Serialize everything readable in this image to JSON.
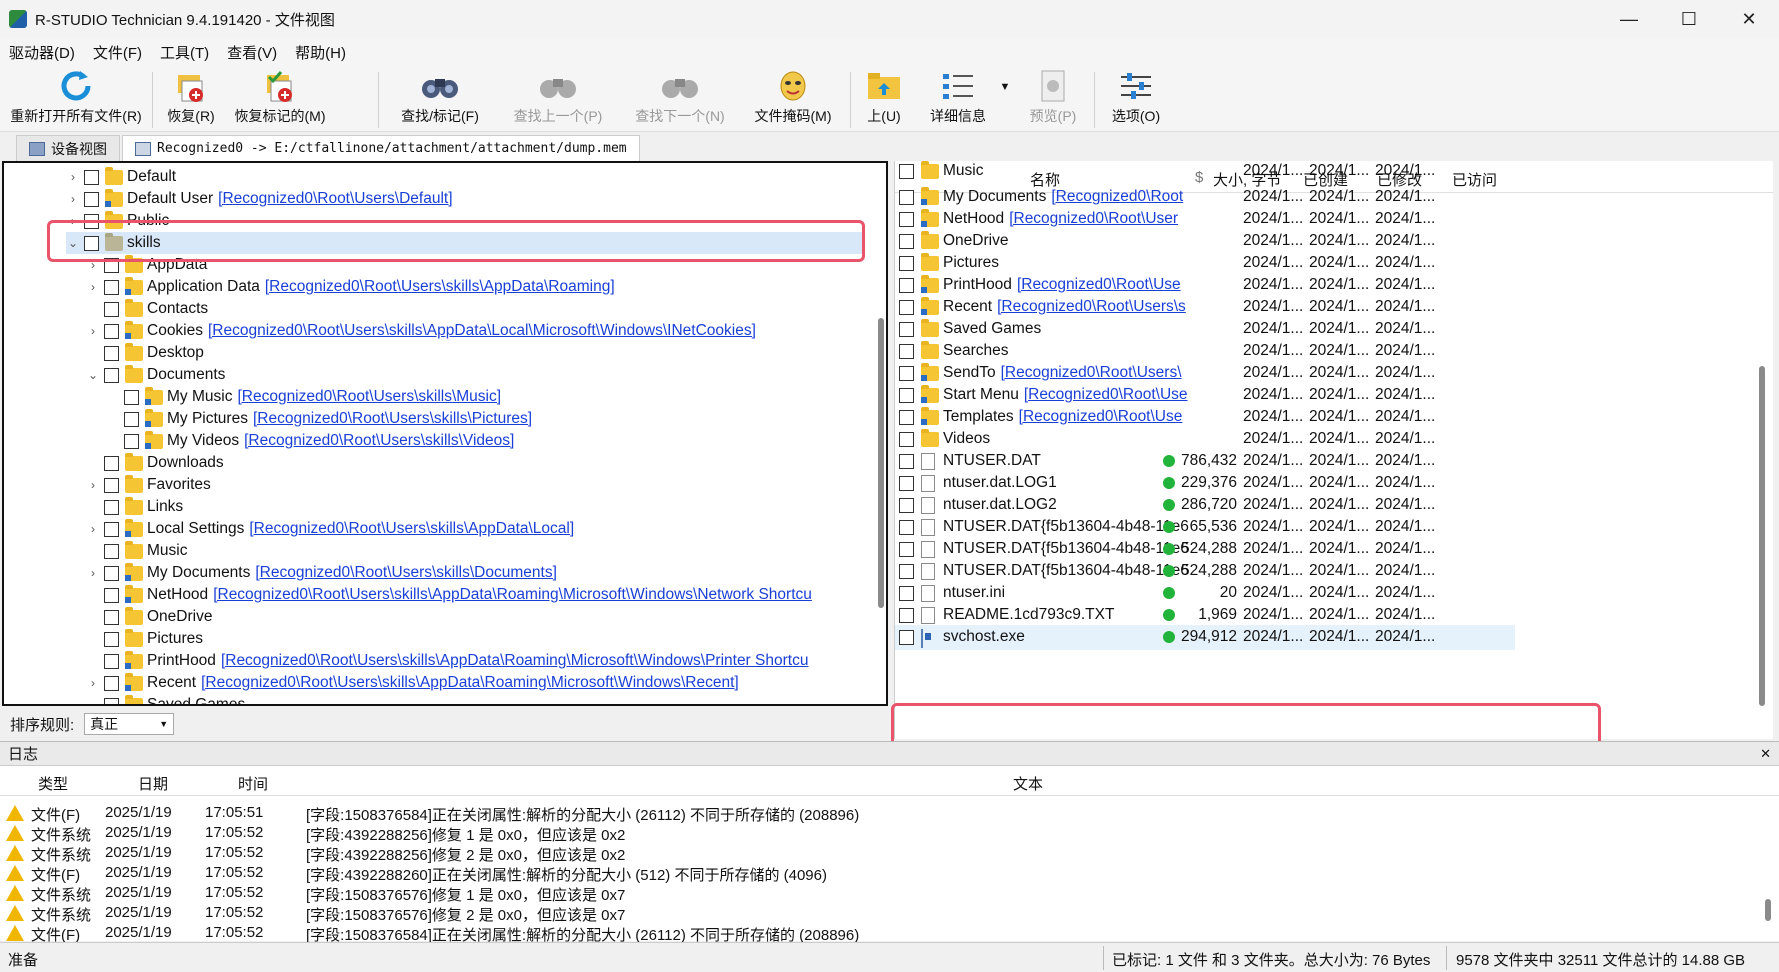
{
  "window": {
    "title": "R-STUDIO Technician 9.4.191420 - 文件视图"
  },
  "menu": [
    "驱动器(D)",
    "文件(F)",
    "工具(T)",
    "查看(V)",
    "帮助(H)"
  ],
  "toolbar": {
    "reopen": "重新打开所有文件(R)",
    "recover": "恢复(R)",
    "recover_marked": "恢复标记的(M)",
    "find_mark": "查找/标记(F)",
    "find_prev": "查找上一个(P)",
    "find_next": "查找下一个(N)",
    "file_mask": "文件掩码(M)",
    "up": "上(U)",
    "details": "详细信息",
    "preview": "预览(P)",
    "options": "选项(O)"
  },
  "tabs": {
    "device_view": "设备视图",
    "file_view": "Recognized0 -> E:/ctfallinone/attachment/attachment/dump.mem"
  },
  "tree": [
    {
      "name": "Default",
      "link": "",
      "level": 0,
      "expander": "›"
    },
    {
      "name": "Default User",
      "link": "[Recognized0\\Root\\Users\\Default]",
      "level": 0,
      "expander": "›"
    },
    {
      "name": "Public",
      "link": "",
      "level": 0,
      "expander": "›"
    },
    {
      "name": "skills",
      "link": "",
      "level": 0,
      "expander": "⌄"
    },
    {
      "name": "AppData",
      "link": "",
      "level": 1,
      "expander": "›"
    },
    {
      "name": "Application Data",
      "link": "[Recognized0\\Root\\Users\\skills\\AppData\\Roaming]",
      "level": 1,
      "expander": "›"
    },
    {
      "name": "Contacts",
      "link": "",
      "level": 1,
      "expander": ""
    },
    {
      "name": "Cookies",
      "link": "[Recognized0\\Root\\Users\\skills\\AppData\\Local\\Microsoft\\Windows\\INetCookies]",
      "level": 1,
      "expander": "›"
    },
    {
      "name": "Desktop",
      "link": "",
      "level": 1,
      "expander": ""
    },
    {
      "name": "Documents",
      "link": "",
      "level": 1,
      "expander": "⌄"
    },
    {
      "name": "My Music",
      "link": "[Recognized0\\Root\\Users\\skills\\Music]",
      "level": 2,
      "expander": ""
    },
    {
      "name": "My Pictures",
      "link": "[Recognized0\\Root\\Users\\skills\\Pictures]",
      "level": 2,
      "expander": ""
    },
    {
      "name": "My Videos",
      "link": "[Recognized0\\Root\\Users\\skills\\Videos]",
      "level": 2,
      "expander": ""
    },
    {
      "name": "Downloads",
      "link": "",
      "level": 1,
      "expander": ""
    },
    {
      "name": "Favorites",
      "link": "",
      "level": 1,
      "expander": "›"
    },
    {
      "name": "Links",
      "link": "",
      "level": 1,
      "expander": ""
    },
    {
      "name": "Local Settings",
      "link": "[Recognized0\\Root\\Users\\skills\\AppData\\Local]",
      "level": 1,
      "expander": "›"
    },
    {
      "name": "Music",
      "link": "",
      "level": 1,
      "expander": ""
    },
    {
      "name": "My Documents",
      "link": "[Recognized0\\Root\\Users\\skills\\Documents]",
      "level": 1,
      "expander": "›"
    },
    {
      "name": "NetHood",
      "link": "[Recognized0\\Root\\Users\\skills\\AppData\\Roaming\\Microsoft\\Windows\\Network Shortcu",
      "level": 1,
      "expander": ""
    },
    {
      "name": "OneDrive",
      "link": "",
      "level": 1,
      "expander": ""
    },
    {
      "name": "Pictures",
      "link": "",
      "level": 1,
      "expander": ""
    },
    {
      "name": "PrintHood",
      "link": "[Recognized0\\Root\\Users\\skills\\AppData\\Roaming\\Microsoft\\Windows\\Printer Shortcu",
      "level": 1,
      "expander": ""
    },
    {
      "name": "Recent",
      "link": "[Recognized0\\Root\\Users\\skills\\AppData\\Roaming\\Microsoft\\Windows\\Recent]",
      "level": 1,
      "expander": "›"
    },
    {
      "name": "Saved Games",
      "link": "",
      "level": 1,
      "expander": ""
    }
  ],
  "sort": {
    "label": "排序规则:",
    "value": "真正"
  },
  "file_columns": {
    "name": "名称",
    "flag": "$",
    "size": "大小, 字节",
    "created": "已创建",
    "modified": "已修改",
    "accessed": "已访问"
  },
  "files": [
    {
      "name": "Music",
      "link": "",
      "type": "folder",
      "size": "",
      "dot": false,
      "created": "2024/1...",
      "modified": "2024/1...",
      "accessed": "2024/1..."
    },
    {
      "name": "My Documents",
      "link": "[Recognized0\\Root",
      "type": "folder",
      "size": "",
      "dot": false,
      "created": "2024/1...",
      "modified": "2024/1...",
      "accessed": "2024/1..."
    },
    {
      "name": "NetHood",
      "link": "[Recognized0\\Root\\User",
      "type": "folder",
      "size": "",
      "dot": false,
      "created": "2024/1...",
      "modified": "2024/1...",
      "accessed": "2024/1..."
    },
    {
      "name": "OneDrive",
      "link": "",
      "type": "folder",
      "size": "",
      "dot": false,
      "created": "2024/1...",
      "modified": "2024/1...",
      "accessed": "2024/1..."
    },
    {
      "name": "Pictures",
      "link": "",
      "type": "folder",
      "size": "",
      "dot": false,
      "created": "2024/1...",
      "modified": "2024/1...",
      "accessed": "2024/1..."
    },
    {
      "name": "PrintHood",
      "link": "[Recognized0\\Root\\Use",
      "type": "folder",
      "size": "",
      "dot": false,
      "created": "2024/1...",
      "modified": "2024/1...",
      "accessed": "2024/1..."
    },
    {
      "name": "Recent",
      "link": "[Recognized0\\Root\\Users\\s",
      "type": "folder",
      "size": "",
      "dot": false,
      "created": "2024/1...",
      "modified": "2024/1...",
      "accessed": "2024/1..."
    },
    {
      "name": "Saved Games",
      "link": "",
      "type": "folder",
      "size": "",
      "dot": false,
      "created": "2024/1...",
      "modified": "2024/1...",
      "accessed": "2024/1..."
    },
    {
      "name": "Searches",
      "link": "",
      "type": "folder",
      "size": "",
      "dot": false,
      "created": "2024/1...",
      "modified": "2024/1...",
      "accessed": "2024/1..."
    },
    {
      "name": "SendTo",
      "link": "[Recognized0\\Root\\Users\\",
      "type": "folder",
      "size": "",
      "dot": false,
      "created": "2024/1...",
      "modified": "2024/1...",
      "accessed": "2024/1..."
    },
    {
      "name": "Start Menu",
      "link": "[Recognized0\\Root\\Use",
      "type": "folder",
      "size": "",
      "dot": false,
      "created": "2024/1...",
      "modified": "2024/1...",
      "accessed": "2024/1..."
    },
    {
      "name": "Templates",
      "link": "[Recognized0\\Root\\Use",
      "type": "folder",
      "size": "",
      "dot": false,
      "created": "2024/1...",
      "modified": "2024/1...",
      "accessed": "2024/1..."
    },
    {
      "name": "Videos",
      "link": "",
      "type": "folder",
      "size": "",
      "dot": false,
      "created": "2024/1...",
      "modified": "2024/1...",
      "accessed": "2024/1..."
    },
    {
      "name": "NTUSER.DAT",
      "link": "",
      "type": "file",
      "size": "786,432",
      "dot": true,
      "created": "2024/1...",
      "modified": "2024/1...",
      "accessed": "2024/1..."
    },
    {
      "name": "ntuser.dat.LOG1",
      "link": "",
      "type": "file",
      "size": "229,376",
      "dot": true,
      "created": "2024/1...",
      "modified": "2024/1...",
      "accessed": "2024/1..."
    },
    {
      "name": "ntuser.dat.LOG2",
      "link": "",
      "type": "file",
      "size": "286,720",
      "dot": true,
      "created": "2024/1...",
      "modified": "2024/1...",
      "accessed": "2024/1..."
    },
    {
      "name": "NTUSER.DAT{f5b13604-4b48-11e6",
      "link": "",
      "type": "file",
      "size": "65,536",
      "dot": true,
      "created": "2024/1...",
      "modified": "2024/1...",
      "accessed": "2024/1..."
    },
    {
      "name": "NTUSER.DAT{f5b13604-4b48-11e6",
      "link": "",
      "type": "file",
      "size": "524,288",
      "dot": true,
      "created": "2024/1...",
      "modified": "2024/1...",
      "accessed": "2024/1..."
    },
    {
      "name": "NTUSER.DAT{f5b13604-4b48-11e6",
      "link": "",
      "type": "file",
      "size": "524,288",
      "dot": true,
      "created": "2024/1...",
      "modified": "2024/1...",
      "accessed": "2024/1..."
    },
    {
      "name": "ntuser.ini",
      "link": "",
      "type": "file",
      "size": "20",
      "dot": true,
      "created": "2024/1...",
      "modified": "2024/1...",
      "accessed": "2024/1..."
    },
    {
      "name": "README.1cd793c9.TXT",
      "link": "",
      "type": "file",
      "size": "1,969",
      "dot": true,
      "created": "2024/1...",
      "modified": "2024/1...",
      "accessed": "2024/1..."
    },
    {
      "name": "svchost.exe",
      "link": "",
      "type": "exe",
      "size": "294,912",
      "dot": true,
      "created": "2024/1...",
      "modified": "2024/1...",
      "accessed": "2024/1..."
    }
  ],
  "log": {
    "title": "日志",
    "columns": {
      "type": "类型",
      "date": "日期",
      "time": "时间",
      "text": "文本"
    },
    "rows": [
      {
        "type": "文件(F)",
        "date": "2025/1/19",
        "time": "17:05:51",
        "text": "[字段:1508376584]正在关闭属性:解析的分配大小 (26112) 不同于所存储的 (208896)"
      },
      {
        "type": "文件系统",
        "date": "2025/1/19",
        "time": "17:05:52",
        "text": "[字段:4392288256]修复 1 是 0x0，但应该是 0x2"
      },
      {
        "type": "文件系统",
        "date": "2025/1/19",
        "time": "17:05:52",
        "text": "[字段:4392288256]修复 2 是 0x0，但应该是 0x2"
      },
      {
        "type": "文件(F)",
        "date": "2025/1/19",
        "time": "17:05:52",
        "text": "[字段:4392288260]正在关闭属性:解析的分配大小 (512) 不同于所存储的 (4096)"
      },
      {
        "type": "文件系统",
        "date": "2025/1/19",
        "time": "17:05:52",
        "text": "[字段:1508376576]修复 1 是 0x0，但应该是 0x7"
      },
      {
        "type": "文件系统",
        "date": "2025/1/19",
        "time": "17:05:52",
        "text": "[字段:1508376576]修复 2 是 0x0，但应该是 0x7"
      },
      {
        "type": "文件(F)",
        "date": "2025/1/19",
        "time": "17:05:52",
        "text": "[字段:1508376584]正在关闭属性:解析的分配大小 (26112) 不同于所存储的 (208896)"
      }
    ]
  },
  "status": {
    "ready": "准备",
    "marked": "已标记: 1 文件 和 3 文件夹。总大小为: 76 Bytes",
    "totals": "9578 文件夹中 32511 文件总计的 14.88 GB"
  }
}
